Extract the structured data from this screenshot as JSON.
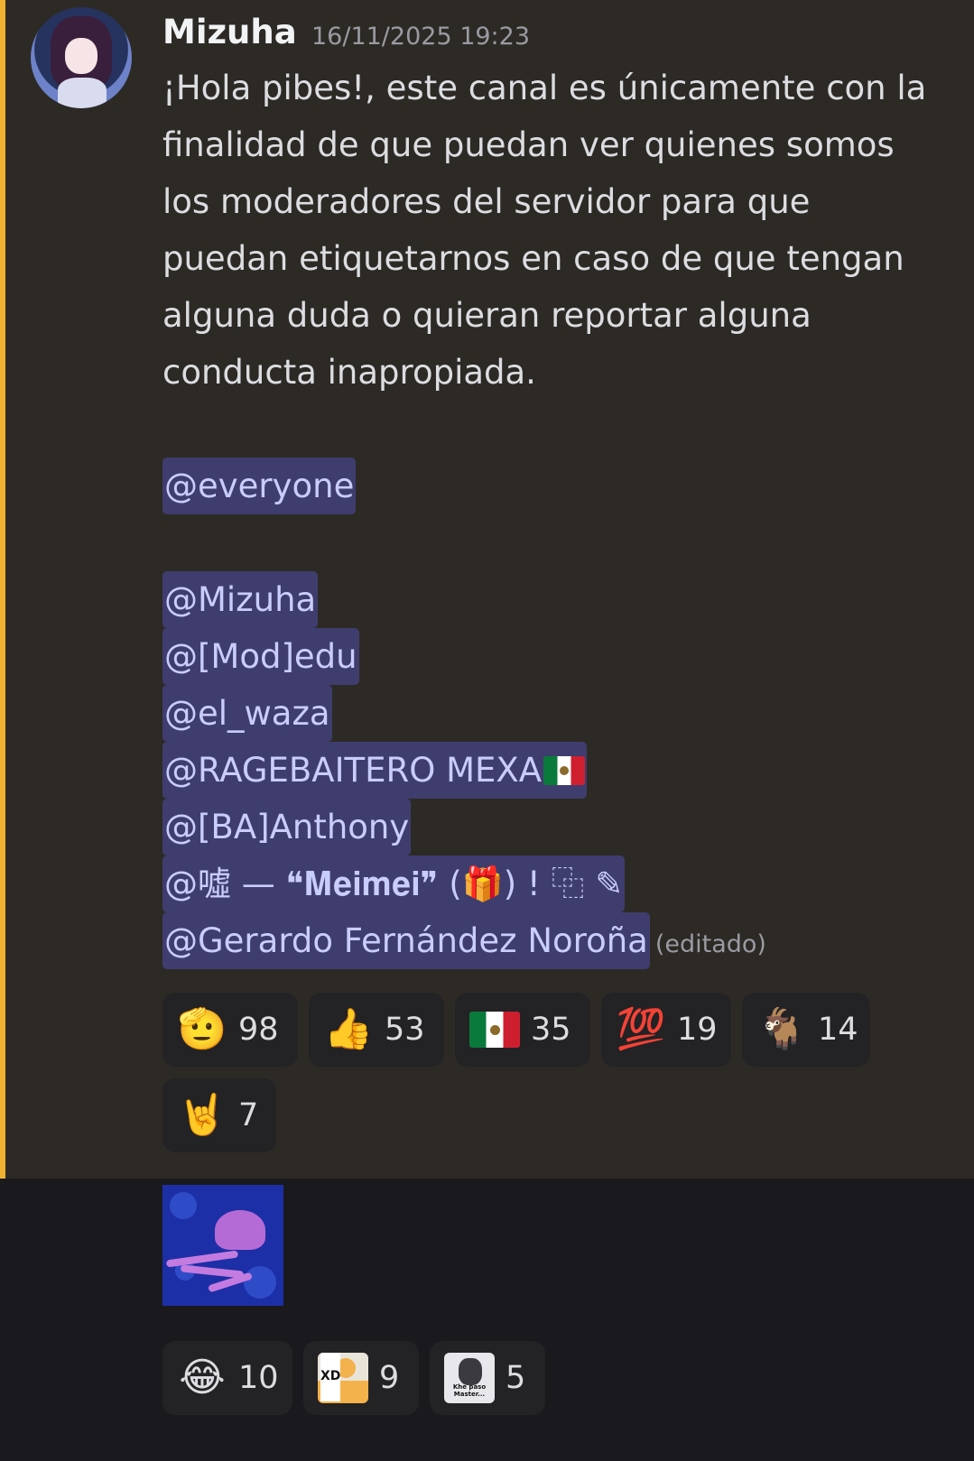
{
  "message": {
    "author": "Mizuha",
    "timestamp": "16/11/2025 19:23",
    "text_lines": [
      "¡Hola pibes!, este canal es únicamente con la",
      "finalidad de que puedan ver quienes somos",
      "los moderadores del servidor para que",
      "puedan etiquetarnos en caso de que tengan",
      "alguna duda o quieran reportar alguna",
      "conducta inapropiada."
    ],
    "everyone_mention": "@everyone",
    "mentions": [
      "@Mizuha",
      "@[Mod]edu",
      "@el_waza",
      "@RAGEBAITERO MEXA",
      "@[BA]Anthony",
      "@噓 — ❝𝐌𝐞𝐢𝐦𝐞𝐢❞ (🎁) ! ⿻ ✎",
      "@Gerardo Fernández Noroña"
    ],
    "edited_label": "(editado)"
  },
  "reactions_1": [
    {
      "icon": "saluting-face-icon",
      "emoji": "🫡",
      "count": "98"
    },
    {
      "icon": "thumbs-up-icon",
      "emoji": "👍",
      "count": "53"
    },
    {
      "icon": "mexico-flag-icon",
      "emoji": "",
      "count": "35"
    },
    {
      "icon": "hundred-points-icon",
      "emoji": "💯",
      "count": "19"
    },
    {
      "icon": "goat-icon",
      "emoji": "🐐",
      "count": "14"
    },
    {
      "icon": "sign-of-horns-icon",
      "emoji": "🤘",
      "count": "7"
    }
  ],
  "reactions_2": [
    {
      "icon": "joy-face-icon",
      "emoji": "😂",
      "count": "10"
    },
    {
      "icon": "xd-custom-emoji-icon",
      "badge_text": "XD",
      "count": "9"
    },
    {
      "icon": "khe-paso-master-emoji-icon",
      "badge_text": "Khe paso Master...",
      "count": "5"
    }
  ],
  "colors": {
    "accent": "#f0b232",
    "mention_bg": "#3f3d6e",
    "mention_text": "#c9cdfb",
    "highlighted_bg": "#2d2a26",
    "app_bg": "#1a1a1e"
  }
}
